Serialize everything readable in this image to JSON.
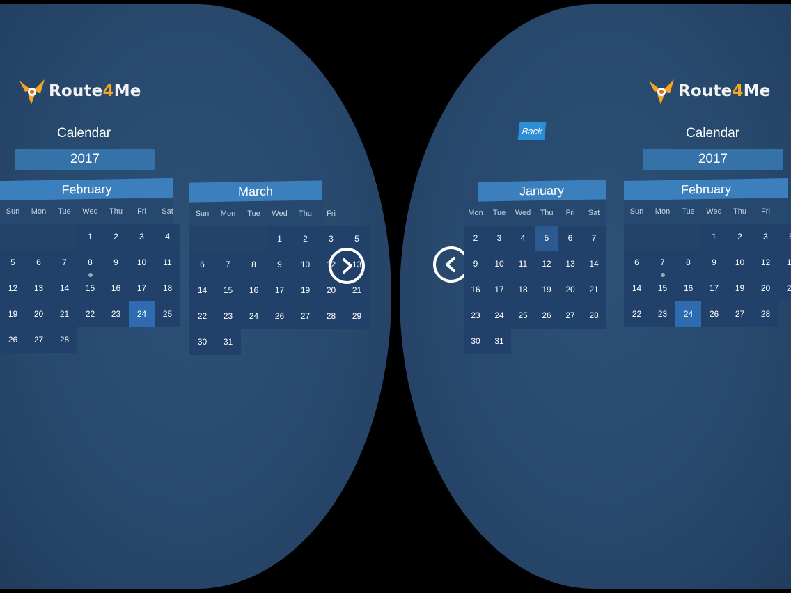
{
  "app": {
    "logo_text_a": "Route",
    "logo_text_b": "4",
    "logo_text_c": "Me"
  },
  "calendar": {
    "title": "Calendar",
    "year": "2017",
    "back_label": "Back",
    "weekdays": [
      "Sun",
      "Mon",
      "Tue",
      "Wed",
      "Thu",
      "Fri",
      "Sat"
    ],
    "weekdays_right_jan": [
      "Mon",
      "Tue",
      "Wed",
      "Thu",
      "Fri",
      "Sat"
    ],
    "left_eye": {
      "month_a": "February",
      "month_b": "March"
    },
    "right_eye": {
      "month_a": "January",
      "month_b": "February"
    },
    "feb_weeks": [
      [
        "",
        "",
        "",
        "1",
        "2",
        "3",
        "4"
      ],
      [
        "5",
        "6",
        "7",
        "8",
        "9",
        "10",
        "11"
      ],
      [
        "12",
        "13",
        "14",
        "15",
        "16",
        "17",
        "18"
      ],
      [
        "19",
        "20",
        "21",
        "22",
        "23",
        "24",
        "25"
      ],
      [
        "26",
        "27",
        "28",
        "",
        "",
        "",
        ""
      ]
    ],
    "mar_weeks": [
      [
        "",
        "",
        "",
        "1",
        "2",
        "3"
      ],
      [
        "5",
        "6",
        "7",
        "8",
        "9",
        "10"
      ],
      [
        "12",
        "13",
        "14",
        "15",
        "16",
        "17"
      ],
      [
        "19",
        "20",
        "21",
        "22",
        "23",
        "24"
      ],
      [
        "26",
        "27",
        "28",
        "29",
        "30",
        "31"
      ]
    ],
    "jan_weeks": [
      [
        "2",
        "3",
        "4",
        "5",
        "6",
        "7"
      ],
      [
        "9",
        "10",
        "11",
        "12",
        "13",
        "14"
      ],
      [
        "16",
        "17",
        "18",
        "19",
        "20",
        "21"
      ],
      [
        "23",
        "24",
        "25",
        "26",
        "27",
        "28"
      ],
      [
        "30",
        "31",
        "",
        "",
        "",
        ""
      ]
    ],
    "feb_right_weeks": [
      [
        "",
        "",
        "",
        "1",
        "2",
        "3"
      ],
      [
        "5",
        "6",
        "7",
        "8",
        "9",
        "10"
      ],
      [
        "12",
        "13",
        "14",
        "15",
        "16",
        "17"
      ],
      [
        "19",
        "20",
        "21",
        "22",
        "23",
        "24"
      ],
      [
        "26",
        "27",
        "28",
        "",
        "",
        ""
      ]
    ],
    "mar_weekdays": [
      "Sun",
      "Mon",
      "Tue",
      "Wed",
      "Thu",
      "Fri"
    ],
    "feb_right_weekdays": [
      "Sun",
      "Mon",
      "Tue",
      "Wed",
      "Thu",
      "Fri"
    ],
    "selected_day": "24",
    "today_day": "5"
  },
  "colors": {
    "accent": "#3b7fbd",
    "selected": "#2f6bb0",
    "background": "#28496d",
    "logo_orange": "#f5a623"
  },
  "icons": {
    "next": "chevron-right-icon",
    "prev": "chevron-left-icon",
    "logo": "route4me-logo-icon"
  }
}
